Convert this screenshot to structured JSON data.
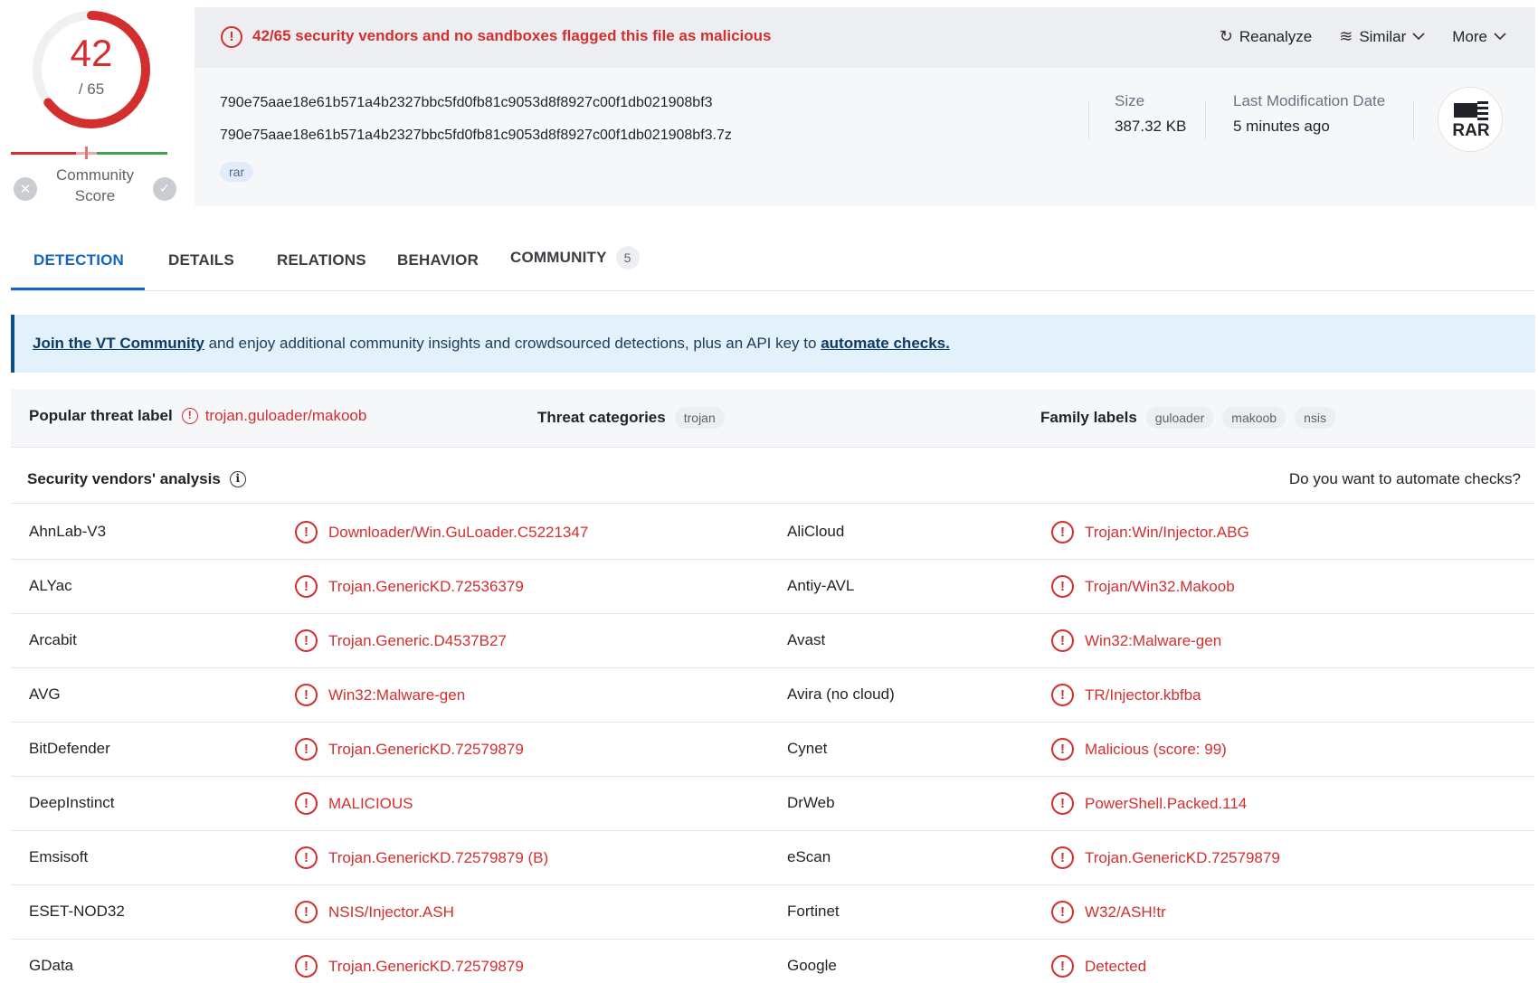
{
  "score": {
    "detections": "42",
    "total": "/ 65",
    "detections_fraction": 0.646,
    "community_label": "Community Score",
    "accent": "#d32f2f"
  },
  "alert": {
    "text": "42/65 security vendors and no sandboxes flagged this file as malicious",
    "icon": "alert-circle-icon"
  },
  "actions": {
    "reanalyze": "Reanalyze",
    "similar": "Similar",
    "more": "More"
  },
  "file": {
    "sha256": "790e75aae18e61b571a4b2327bbc5fd0fb81c9053d8f8927c00f1db021908bf3",
    "name": "790e75aae18e61b571a4b2327bbc5fd0fb81c9053d8f8927c00f1db021908bf3.7z",
    "tag": "rar",
    "size_label": "Size",
    "size_value": "387.32 KB",
    "date_label": "Last Modification Date",
    "date_value": "5 minutes ago",
    "type_label": "RAR"
  },
  "tabs": [
    {
      "label": "DETECTION",
      "active": true
    },
    {
      "label": "DETAILS",
      "active": false
    },
    {
      "label": "RELATIONS",
      "active": false
    },
    {
      "label": "BEHAVIOR",
      "active": false
    },
    {
      "label": "COMMUNITY",
      "active": false,
      "badge": "5"
    }
  ],
  "banner": {
    "link1": "Join the VT Community",
    "middle": " and enjoy additional community insights and crowdsourced detections, plus an API key to ",
    "link2": "automate checks."
  },
  "threat": {
    "popular_label": "Popular threat label",
    "popular_value": "trojan.guloader/makoob",
    "categories_label": "Threat categories",
    "categories": [
      "trojan"
    ],
    "family_label": "Family labels",
    "families": [
      "guloader",
      "makoob",
      "nsis"
    ]
  },
  "vendors": {
    "title": "Security vendors' analysis",
    "automate": "Do you want to automate checks?",
    "rows": [
      {
        "v1": "AhnLab-V3",
        "r1": "Downloader/Win.GuLoader.C5221347",
        "v2": "AliCloud",
        "r2": "Trojan:Win/Injector.ABG"
      },
      {
        "v1": "ALYac",
        "r1": "Trojan.GenericKD.72536379",
        "v2": "Antiy-AVL",
        "r2": "Trojan/Win32.Makoob"
      },
      {
        "v1": "Arcabit",
        "r1": "Trojan.Generic.D4537B27",
        "v2": "Avast",
        "r2": "Win32:Malware-gen"
      },
      {
        "v1": "AVG",
        "r1": "Win32:Malware-gen",
        "v2": "Avira (no cloud)",
        "r2": "TR/Injector.kbfba"
      },
      {
        "v1": "BitDefender",
        "r1": "Trojan.GenericKD.72579879",
        "v2": "Cynet",
        "r2": "Malicious (score: 99)"
      },
      {
        "v1": "DeepInstinct",
        "r1": "MALICIOUS",
        "v2": "DrWeb",
        "r2": "PowerShell.Packed.114"
      },
      {
        "v1": "Emsisoft",
        "r1": "Trojan.GenericKD.72579879 (B)",
        "v2": "eScan",
        "r2": "Trojan.GenericKD.72579879"
      },
      {
        "v1": "ESET-NOD32",
        "r1": "NSIS/Injector.ASH",
        "v2": "Fortinet",
        "r2": "W32/ASH!tr"
      },
      {
        "v1": "GData",
        "r1": "Trojan.GenericKD.72579879",
        "v2": "Google",
        "r2": "Detected"
      }
    ]
  }
}
